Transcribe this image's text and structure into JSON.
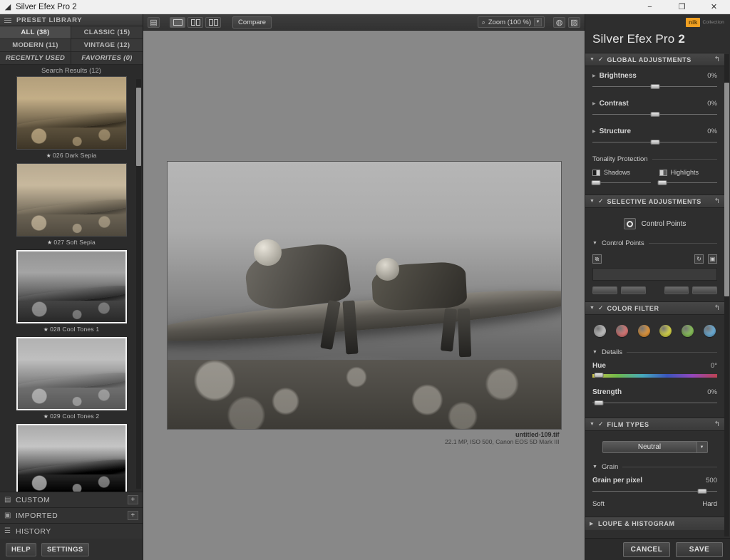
{
  "window": {
    "title": "Silver Efex Pro 2",
    "app_icon": "app-logo-icon",
    "minimize": "−",
    "maximize": "❐",
    "close": "✕"
  },
  "left_panel": {
    "header": {
      "title": "PRESET LIBRARY",
      "menu_icon": "hamburger-icon"
    },
    "tabs": [
      {
        "label": "ALL (38)",
        "active": true,
        "italic": false
      },
      {
        "label": "CLASSIC (15)",
        "active": false,
        "italic": false
      },
      {
        "label": "MODERN (11)",
        "active": false,
        "italic": false
      },
      {
        "label": "VINTAGE (12)",
        "active": false,
        "italic": false
      },
      {
        "label": "RECENTLY USED",
        "active": false,
        "italic": true
      },
      {
        "label": "FAVORITES (0)",
        "active": false,
        "italic": true
      }
    ],
    "search_results": "Search Results (12)",
    "presets": [
      {
        "label": "026 Dark Sepia",
        "star": "★",
        "selected": false,
        "style": "sepia"
      },
      {
        "label": "027 Soft Sepia",
        "star": "★",
        "selected": false,
        "style": "sepia-soft"
      },
      {
        "label": "028 Cool Tones 1",
        "star": "★",
        "selected": true,
        "style": "cool1"
      },
      {
        "label": "029 Cool Tones 2",
        "star": "★",
        "selected": true,
        "style": "cool2"
      },
      {
        "label": "",
        "star": "",
        "selected": true,
        "style": "high"
      }
    ],
    "sections": [
      {
        "label": "CUSTOM",
        "icon": "custom-preset-icon",
        "add": "+"
      },
      {
        "label": "IMPORTED",
        "icon": "imported-preset-icon",
        "add": "+"
      },
      {
        "label": "HISTORY",
        "icon": "history-icon",
        "add": ""
      }
    ],
    "buttons": {
      "help": "HELP",
      "settings": "SETTINGS"
    }
  },
  "toolbar": {
    "menu_icon": "panel-toggle-icon",
    "views": [
      {
        "name": "single-view-icon",
        "active": true
      },
      {
        "name": "split-view-icon",
        "active": false
      },
      {
        "name": "side-by-side-view-icon",
        "active": false
      }
    ],
    "compare_label": "Compare",
    "zoom": {
      "icon": "magnifier-icon",
      "label": "Zoom (100 %)",
      "arrow": "▼"
    },
    "right_buttons": [
      {
        "name": "loupe-toggle-icon"
      },
      {
        "name": "histogram-toggle-icon"
      }
    ]
  },
  "image": {
    "filename": "untitled-109.tif",
    "metadata": "22.1 MP, ISO 500, Canon EOS 5D Mark III"
  },
  "right_panel": {
    "logo": {
      "brand": "nik",
      "sub": "Collection"
    },
    "title_light": "Silver Efex Pro",
    "title_bold": "2",
    "global": {
      "section": "GLOBAL ADJUSTMENTS",
      "check": "✓",
      "reset_icon": "reset-arrow-icon",
      "sliders": [
        {
          "name": "Brightness",
          "value": "0%",
          "pos": 50
        },
        {
          "name": "Contrast",
          "value": "0%",
          "pos": 50
        },
        {
          "name": "Structure",
          "value": "0%",
          "pos": 50
        }
      ],
      "tonality_label": "Tonality Protection",
      "tonality": [
        {
          "label": "Shadows",
          "icon": "shadows-icon",
          "pos": 6
        },
        {
          "label": "Highlights",
          "icon": "highlights-icon",
          "pos": 6
        }
      ]
    },
    "selective": {
      "section": "SELECTIVE ADJUSTMENTS",
      "check": "✓",
      "reset_icon": "reset-arrow-icon",
      "control_points_button": "Control Points",
      "control_points_group": "Control Points",
      "tools": [
        {
          "name": "duplicate-control-point-icon",
          "glyph": "⧉"
        },
        {
          "name": "reset-control-points-icon",
          "glyph": "↻"
        },
        {
          "name": "group-control-points-icon",
          "glyph": "▣"
        }
      ]
    },
    "color_filter": {
      "section": "COLOR FILTER",
      "check": "✓",
      "reset_icon": "reset-arrow-icon",
      "swatches": [
        "#c9c9c9",
        "#e07a78",
        "#e89a3c",
        "#ded councilor",
        "#8dc85c",
        "#6fb4e0"
      ],
      "swatch_colors": [
        "#c9c9c9",
        "#e07a78",
        "#e89a3c",
        "#dedc4a",
        "#8dc85c",
        "#6fb4e0"
      ],
      "details_label": "Details",
      "hue": {
        "name": "Hue",
        "value": "0°",
        "pos": 4
      },
      "strength": {
        "name": "Strength",
        "value": "0%",
        "pos": 4
      }
    },
    "film_types": {
      "section": "FILM TYPES",
      "check": "✓",
      "reset_icon": "reset-arrow-icon",
      "selected_film": "Neutral",
      "dropdown_arrow": "▼",
      "grain_label": "Grain",
      "grain_per_pixel": {
        "name": "Grain per pixel",
        "value": "500",
        "pos": 88
      },
      "soft": "Soft",
      "hard": "Hard"
    },
    "loupe": {
      "section": "LOUPE & HISTOGRAM",
      "tri": "▶"
    },
    "footer": {
      "cancel": "CANCEL",
      "save": "SAVE"
    }
  }
}
